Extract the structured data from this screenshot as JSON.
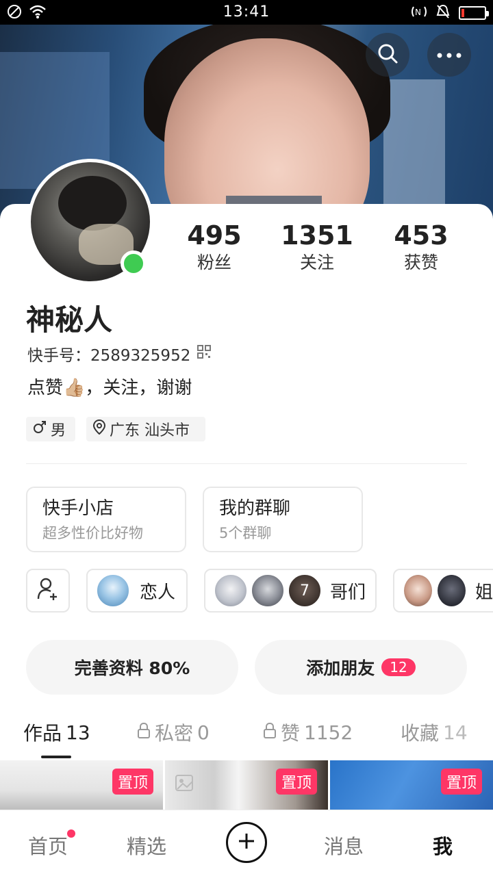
{
  "status_bar": {
    "time": "13:41"
  },
  "stats": [
    {
      "number": "495",
      "label": "粉丝"
    },
    {
      "number": "1351",
      "label": "关注"
    },
    {
      "number": "453",
      "label": "获赞"
    }
  ],
  "profile": {
    "name": "神秘人",
    "kuaishou_id_label": "快手号：2589325952",
    "bio": "点赞👍🏼，关注，谢谢",
    "gender_tag": "男",
    "location_tag": "广东 汕头市"
  },
  "feature_boxes": [
    {
      "title": "快手小店",
      "subtitle": "超多性价比好物"
    },
    {
      "title": "我的群聊",
      "subtitle": "5个群聊"
    }
  ],
  "relations": {
    "lover_label": "恋人",
    "bros_label": "哥们",
    "bros_extra_count": "7",
    "sisters_label": "姐"
  },
  "actions": {
    "complete_profile_label": "完善资料 80%",
    "add_friend_label": "添加朋友",
    "add_friend_badge": "12"
  },
  "tabs": [
    {
      "label": "作品",
      "count": "13"
    },
    {
      "label": "私密",
      "count": "0"
    },
    {
      "label": "赞",
      "count": "1152"
    },
    {
      "label": "收藏",
      "count": "14"
    }
  ],
  "pinned_label": "置顶",
  "bottom_nav": {
    "home": "首页",
    "featured": "精选",
    "messages": "消息",
    "me": "我"
  },
  "colors": {
    "accent": "#fe3666",
    "online": "#3fcb52"
  }
}
